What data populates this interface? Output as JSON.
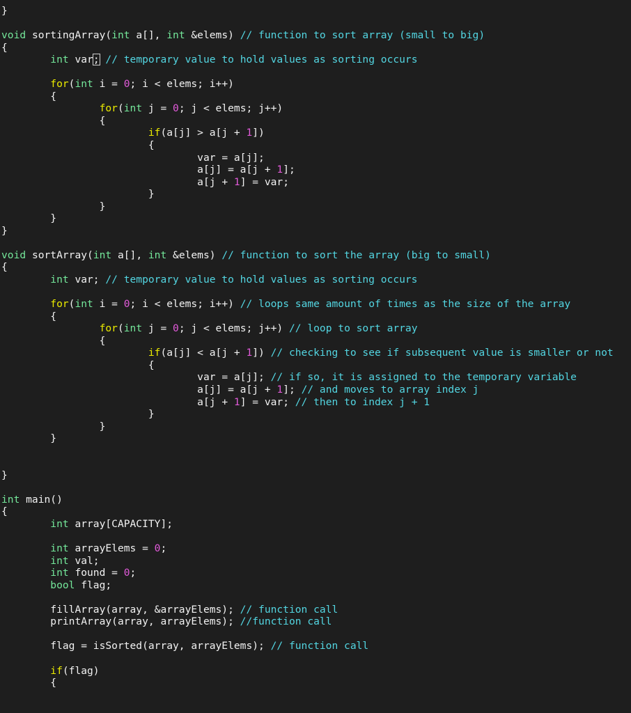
{
  "editor": {
    "language": "cpp",
    "background_color": "#1e1e1e",
    "foreground_color": "#f2f2f2",
    "cursor_char": ";",
    "theme_colors": {
      "type_keyword": "#74e79a",
      "control_keyword": "#eaea00",
      "number": "#e25ada",
      "comment": "#53d6e2",
      "plain": "#f2f2f2"
    }
  },
  "lines": [
    {
      "id": "l1",
      "indent": 0,
      "tokens": [
        {
          "t": "}",
          "c": "pln"
        }
      ]
    },
    {
      "id": "l2",
      "indent": 0,
      "tokens": []
    },
    {
      "id": "l3",
      "indent": 0,
      "tokens": [
        {
          "t": "void",
          "c": "kw"
        },
        {
          "t": " sortingArray(",
          "c": "pln"
        },
        {
          "t": "int",
          "c": "kw"
        },
        {
          "t": " a[], ",
          "c": "pln"
        },
        {
          "t": "int",
          "c": "kw"
        },
        {
          "t": " &elems) ",
          "c": "pln"
        },
        {
          "t": "// function to sort array (small to big)",
          "c": "cmt"
        }
      ]
    },
    {
      "id": "l4",
      "indent": 0,
      "tokens": [
        {
          "t": "{",
          "c": "pln"
        }
      ]
    },
    {
      "id": "l5",
      "indent": 1,
      "tokens": [
        {
          "t": "int",
          "c": "kw"
        },
        {
          "t": " var",
          "c": "pln"
        },
        {
          "t": ";",
          "c": "cursor"
        },
        {
          "t": " ",
          "c": "pln"
        },
        {
          "t": "// temporary value to hold values as sorting occurs",
          "c": "cmt"
        }
      ]
    },
    {
      "id": "l6",
      "indent": 0,
      "tokens": []
    },
    {
      "id": "l7",
      "indent": 1,
      "tokens": [
        {
          "t": "for",
          "c": "ctl"
        },
        {
          "t": "(",
          "c": "pln"
        },
        {
          "t": "int",
          "c": "kw"
        },
        {
          "t": " i = ",
          "c": "pln"
        },
        {
          "t": "0",
          "c": "num"
        },
        {
          "t": "; i < elems; i++)",
          "c": "pln"
        }
      ]
    },
    {
      "id": "l8",
      "indent": 1,
      "tokens": [
        {
          "t": "{",
          "c": "pln"
        }
      ]
    },
    {
      "id": "l9",
      "indent": 2,
      "tokens": [
        {
          "t": "for",
          "c": "ctl"
        },
        {
          "t": "(",
          "c": "pln"
        },
        {
          "t": "int",
          "c": "kw"
        },
        {
          "t": " j = ",
          "c": "pln"
        },
        {
          "t": "0",
          "c": "num"
        },
        {
          "t": "; j < elems; j++)",
          "c": "pln"
        }
      ]
    },
    {
      "id": "l10",
      "indent": 2,
      "tokens": [
        {
          "t": "{",
          "c": "pln"
        }
      ]
    },
    {
      "id": "l11",
      "indent": 3,
      "tokens": [
        {
          "t": "if",
          "c": "ctl"
        },
        {
          "t": "(a[j] > a[j + ",
          "c": "pln"
        },
        {
          "t": "1",
          "c": "num"
        },
        {
          "t": "])",
          "c": "pln"
        }
      ]
    },
    {
      "id": "l12",
      "indent": 3,
      "tokens": [
        {
          "t": "{",
          "c": "pln"
        }
      ]
    },
    {
      "id": "l13",
      "indent": 4,
      "tokens": [
        {
          "t": "var = a[j];",
          "c": "pln"
        }
      ]
    },
    {
      "id": "l14",
      "indent": 4,
      "tokens": [
        {
          "t": "a[j] = a[j + ",
          "c": "pln"
        },
        {
          "t": "1",
          "c": "num"
        },
        {
          "t": "];",
          "c": "pln"
        }
      ]
    },
    {
      "id": "l15",
      "indent": 4,
      "tokens": [
        {
          "t": "a[j + ",
          "c": "pln"
        },
        {
          "t": "1",
          "c": "num"
        },
        {
          "t": "] = var;",
          "c": "pln"
        }
      ]
    },
    {
      "id": "l16",
      "indent": 3,
      "tokens": [
        {
          "t": "}",
          "c": "pln"
        }
      ]
    },
    {
      "id": "l17",
      "indent": 2,
      "tokens": [
        {
          "t": "}",
          "c": "pln"
        }
      ]
    },
    {
      "id": "l18",
      "indent": 1,
      "tokens": [
        {
          "t": "}",
          "c": "pln"
        }
      ]
    },
    {
      "id": "l19",
      "indent": 0,
      "tokens": [
        {
          "t": "}",
          "c": "pln"
        }
      ]
    },
    {
      "id": "l20",
      "indent": 0,
      "tokens": []
    },
    {
      "id": "l21",
      "indent": 0,
      "tokens": [
        {
          "t": "void",
          "c": "kw"
        },
        {
          "t": " sortArray(",
          "c": "pln"
        },
        {
          "t": "int",
          "c": "kw"
        },
        {
          "t": " a[], ",
          "c": "pln"
        },
        {
          "t": "int",
          "c": "kw"
        },
        {
          "t": " &elems) ",
          "c": "pln"
        },
        {
          "t": "// function to sort the array (big to small)",
          "c": "cmt"
        }
      ]
    },
    {
      "id": "l22",
      "indent": 0,
      "tokens": [
        {
          "t": "{",
          "c": "pln"
        }
      ]
    },
    {
      "id": "l23",
      "indent": 1,
      "tokens": [
        {
          "t": "int",
          "c": "kw"
        },
        {
          "t": " var; ",
          "c": "pln"
        },
        {
          "t": "// temporary value to hold values as sorting occurs",
          "c": "cmt"
        }
      ]
    },
    {
      "id": "l24",
      "indent": 0,
      "tokens": []
    },
    {
      "id": "l25",
      "indent": 1,
      "tokens": [
        {
          "t": "for",
          "c": "ctl"
        },
        {
          "t": "(",
          "c": "pln"
        },
        {
          "t": "int",
          "c": "kw"
        },
        {
          "t": " i = ",
          "c": "pln"
        },
        {
          "t": "0",
          "c": "num"
        },
        {
          "t": "; i < elems; i++) ",
          "c": "pln"
        },
        {
          "t": "// loops same amount of times as the size of the array",
          "c": "cmt"
        }
      ]
    },
    {
      "id": "l26",
      "indent": 1,
      "tokens": [
        {
          "t": "{",
          "c": "pln"
        }
      ]
    },
    {
      "id": "l27",
      "indent": 2,
      "tokens": [
        {
          "t": "for",
          "c": "ctl"
        },
        {
          "t": "(",
          "c": "pln"
        },
        {
          "t": "int",
          "c": "kw"
        },
        {
          "t": " j = ",
          "c": "pln"
        },
        {
          "t": "0",
          "c": "num"
        },
        {
          "t": "; j < elems; j++) ",
          "c": "pln"
        },
        {
          "t": "// loop to sort array",
          "c": "cmt"
        }
      ]
    },
    {
      "id": "l28",
      "indent": 2,
      "tokens": [
        {
          "t": "{",
          "c": "pln"
        }
      ]
    },
    {
      "id": "l29",
      "indent": 3,
      "tokens": [
        {
          "t": "if",
          "c": "ctl"
        },
        {
          "t": "(a[j] < a[j + ",
          "c": "pln"
        },
        {
          "t": "1",
          "c": "num"
        },
        {
          "t": "]) ",
          "c": "pln"
        },
        {
          "t": "// checking to see if subsequent value is smaller or not",
          "c": "cmt"
        }
      ]
    },
    {
      "id": "l30",
      "indent": 3,
      "tokens": [
        {
          "t": "{",
          "c": "pln"
        }
      ]
    },
    {
      "id": "l31",
      "indent": 4,
      "tokens": [
        {
          "t": "var = a[j]; ",
          "c": "pln"
        },
        {
          "t": "// if so, it is assigned to the temporary variable",
          "c": "cmt"
        }
      ]
    },
    {
      "id": "l32",
      "indent": 4,
      "tokens": [
        {
          "t": "a[j] = a[j + ",
          "c": "pln"
        },
        {
          "t": "1",
          "c": "num"
        },
        {
          "t": "]; ",
          "c": "pln"
        },
        {
          "t": "// and moves to array index j",
          "c": "cmt"
        }
      ]
    },
    {
      "id": "l33",
      "indent": 4,
      "tokens": [
        {
          "t": "a[j + ",
          "c": "pln"
        },
        {
          "t": "1",
          "c": "num"
        },
        {
          "t": "] = var; ",
          "c": "pln"
        },
        {
          "t": "// then to index j + 1",
          "c": "cmt"
        }
      ]
    },
    {
      "id": "l34",
      "indent": 3,
      "tokens": [
        {
          "t": "}",
          "c": "pln"
        }
      ]
    },
    {
      "id": "l35",
      "indent": 2,
      "tokens": [
        {
          "t": "}",
          "c": "pln"
        }
      ]
    },
    {
      "id": "l36",
      "indent": 1,
      "tokens": [
        {
          "t": "}",
          "c": "pln"
        }
      ]
    },
    {
      "id": "l37",
      "indent": 0,
      "tokens": []
    },
    {
      "id": "l38",
      "indent": 0,
      "tokens": []
    },
    {
      "id": "l39",
      "indent": 0,
      "tokens": [
        {
          "t": "}",
          "c": "pln"
        }
      ]
    },
    {
      "id": "l40",
      "indent": 0,
      "tokens": []
    },
    {
      "id": "l41",
      "indent": 0,
      "tokens": [
        {
          "t": "int",
          "c": "kw"
        },
        {
          "t": " main()",
          "c": "pln"
        }
      ]
    },
    {
      "id": "l42",
      "indent": 0,
      "tokens": [
        {
          "t": "{",
          "c": "pln"
        }
      ]
    },
    {
      "id": "l43",
      "indent": 1,
      "tokens": [
        {
          "t": "int",
          "c": "kw"
        },
        {
          "t": " array[CAPACITY];",
          "c": "pln"
        }
      ]
    },
    {
      "id": "l44",
      "indent": 0,
      "tokens": []
    },
    {
      "id": "l45",
      "indent": 1,
      "tokens": [
        {
          "t": "int",
          "c": "kw"
        },
        {
          "t": " arrayElems = ",
          "c": "pln"
        },
        {
          "t": "0",
          "c": "num"
        },
        {
          "t": ";",
          "c": "pln"
        }
      ]
    },
    {
      "id": "l46",
      "indent": 1,
      "tokens": [
        {
          "t": "int",
          "c": "kw"
        },
        {
          "t": " val;",
          "c": "pln"
        }
      ]
    },
    {
      "id": "l47",
      "indent": 1,
      "tokens": [
        {
          "t": "int",
          "c": "kw"
        },
        {
          "t": " found = ",
          "c": "pln"
        },
        {
          "t": "0",
          "c": "num"
        },
        {
          "t": ";",
          "c": "pln"
        }
      ]
    },
    {
      "id": "l48",
      "indent": 1,
      "tokens": [
        {
          "t": "bool",
          "c": "kw"
        },
        {
          "t": " flag;",
          "c": "pln"
        }
      ]
    },
    {
      "id": "l49",
      "indent": 0,
      "tokens": []
    },
    {
      "id": "l50",
      "indent": 1,
      "tokens": [
        {
          "t": "fillArray(array, &arrayElems); ",
          "c": "pln"
        },
        {
          "t": "// function call",
          "c": "cmt"
        }
      ]
    },
    {
      "id": "l51",
      "indent": 1,
      "tokens": [
        {
          "t": "printArray(array, arrayElems); ",
          "c": "pln"
        },
        {
          "t": "//function call",
          "c": "cmt"
        }
      ]
    },
    {
      "id": "l52",
      "indent": 0,
      "tokens": []
    },
    {
      "id": "l53",
      "indent": 1,
      "tokens": [
        {
          "t": "flag = isSorted(array, arrayElems); ",
          "c": "pln"
        },
        {
          "t": "// function call",
          "c": "cmt"
        }
      ]
    },
    {
      "id": "l54",
      "indent": 0,
      "tokens": []
    },
    {
      "id": "l55",
      "indent": 1,
      "tokens": [
        {
          "t": "if",
          "c": "ctl"
        },
        {
          "t": "(flag)",
          "c": "pln"
        }
      ]
    },
    {
      "id": "l56",
      "indent": 1,
      "tokens": [
        {
          "t": "{",
          "c": "pln"
        }
      ]
    }
  ]
}
